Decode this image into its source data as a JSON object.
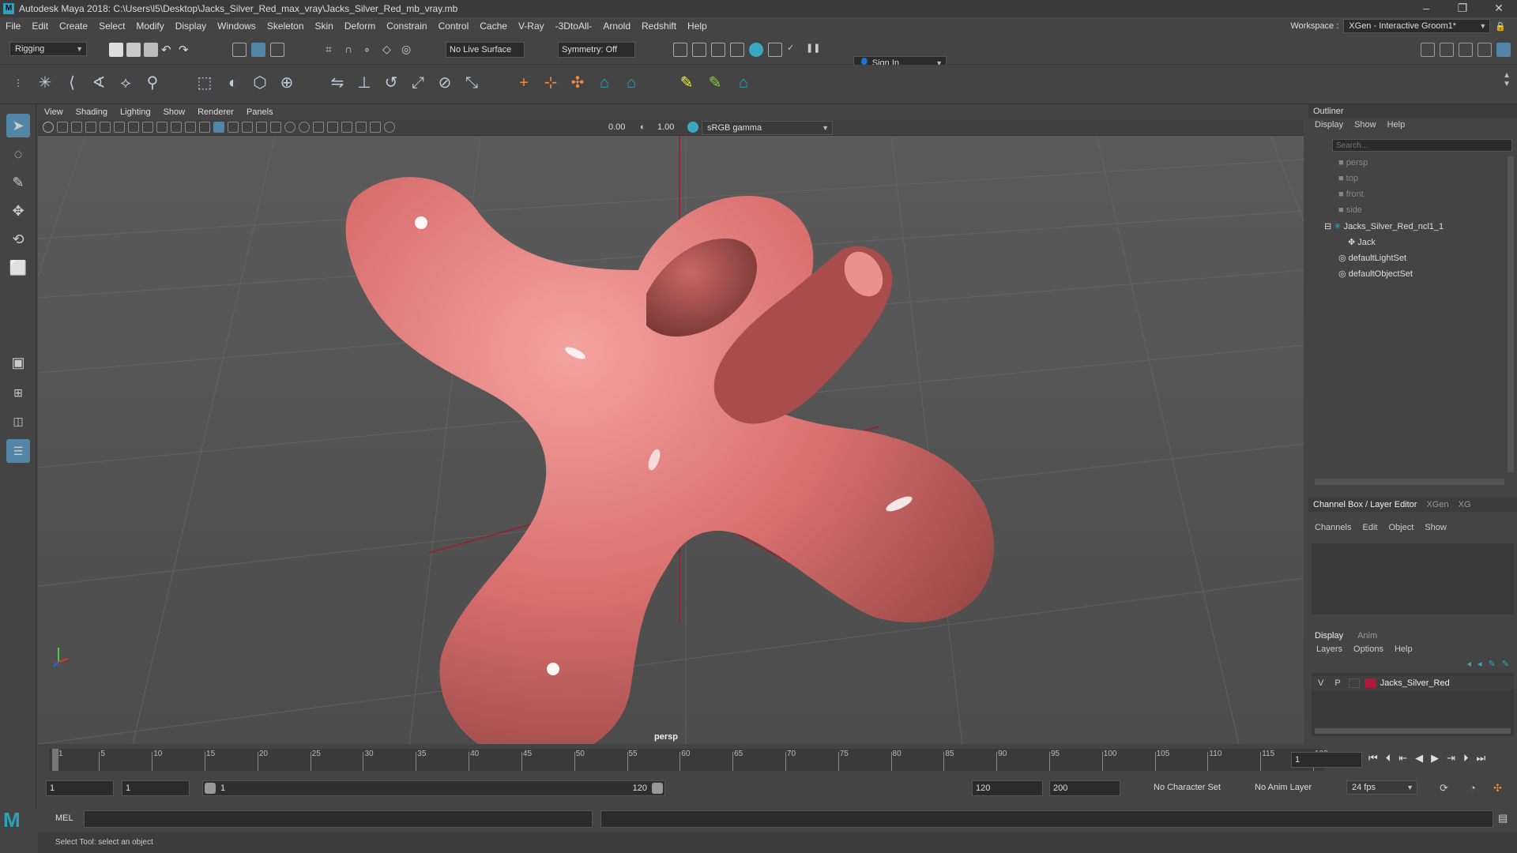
{
  "window": {
    "title": "Autodesk Maya 2018: C:\\Users\\l5\\Desktop\\Jacks_Silver_Red_max_vray\\Jacks_Silver_Red_mb_vray.mb"
  },
  "menu": [
    "File",
    "Edit",
    "Create",
    "Select",
    "Modify",
    "Display",
    "Windows",
    "Skeleton",
    "Skin",
    "Deform",
    "Constrain",
    "Control",
    "Cache",
    "V-Ray",
    "-3DtoAll-",
    "Arnold",
    "Redshift",
    "Help"
  ],
  "workspace": {
    "label": "Workspace :",
    "value": "XGen - Interactive Groom1*"
  },
  "status": {
    "mode": "Rigging",
    "live_surface": "No Live Surface",
    "symmetry": "Symmetry: Off",
    "sign_in": "Sign In"
  },
  "viewport": {
    "menu": [
      "View",
      "Shading",
      "Lighting",
      "Show",
      "Renderer",
      "Panels"
    ],
    "exposure": "0.00",
    "gamma": "1.00",
    "color_space": "sRGB gamma",
    "camera_label": "persp"
  },
  "outliner": {
    "title": "Outliner",
    "menu": [
      "Display",
      "Show",
      "Help"
    ],
    "search_placeholder": "Search...",
    "items": [
      "persp",
      "top",
      "front",
      "side",
      "Jacks_Silver_Red_ncl1_1",
      "Jack",
      "defaultLightSet",
      "defaultObjectSet"
    ]
  },
  "channelbox": {
    "tabs": [
      "Channel Box / Layer Editor",
      "XGen",
      "XG"
    ],
    "menu": [
      "Channels",
      "Edit",
      "Object",
      "Show"
    ]
  },
  "layers": {
    "tabs": [
      "Display",
      "Anim"
    ],
    "menu": [
      "Layers",
      "Options",
      "Help"
    ],
    "layer": {
      "v": "V",
      "p": "P",
      "name": "Jacks_Silver_Red",
      "color": "#b0173a"
    }
  },
  "timeslider": {
    "ticks": [
      "1",
      "5",
      "10",
      "15",
      "20",
      "25",
      "30",
      "35",
      "40",
      "45",
      "50",
      "55",
      "60",
      "65",
      "70",
      "75",
      "80",
      "85",
      "90",
      "95",
      "100",
      "105",
      "110",
      "115",
      "120"
    ],
    "current_frame": "1"
  },
  "range": {
    "start": "1",
    "playback_start": "1",
    "range_start": "1",
    "range_end": "120",
    "playback_end": "120",
    "end": "200",
    "character_set": "No Character Set",
    "anim_layer": "No Anim Layer",
    "fps": "24 fps"
  },
  "cmdline": {
    "label": "MEL"
  },
  "helpline": {
    "text": "Select Tool: select an object"
  },
  "colors": {
    "object": "#e07a78",
    "axis": "#9b1f2c"
  }
}
